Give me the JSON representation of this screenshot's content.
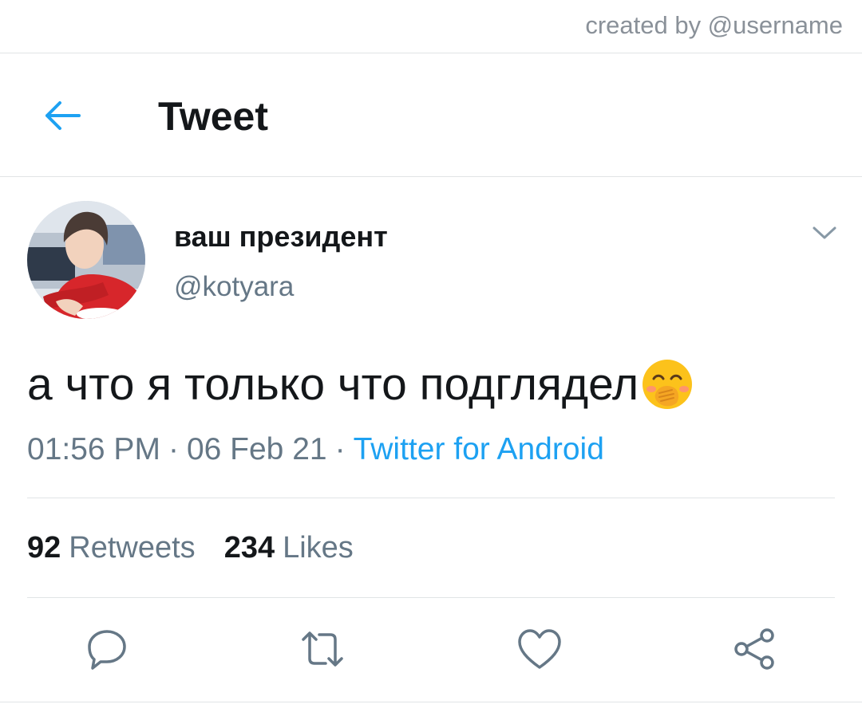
{
  "watermark": "created by @username",
  "header": {
    "back_icon": "arrow-left-icon",
    "title": "Tweet"
  },
  "tweet": {
    "display_name": "ваш президент",
    "handle": "@kotyara",
    "text": "а что я только что подглядел",
    "emoji": "face-with-hand-over-mouth",
    "time": "01:56 PM",
    "separator": "·",
    "date": "06 Feb 21",
    "source": "Twitter for Android"
  },
  "stats": {
    "retweets_count": "92",
    "retweets_label": "Retweets",
    "likes_count": "234",
    "likes_label": "Likes"
  },
  "actions": [
    "reply-icon",
    "retweet-icon",
    "like-icon",
    "share-icon"
  ],
  "colors": {
    "accent": "#1da1f2",
    "text": "#14171a",
    "secondary": "#657786",
    "divider": "#e1e4e6"
  }
}
